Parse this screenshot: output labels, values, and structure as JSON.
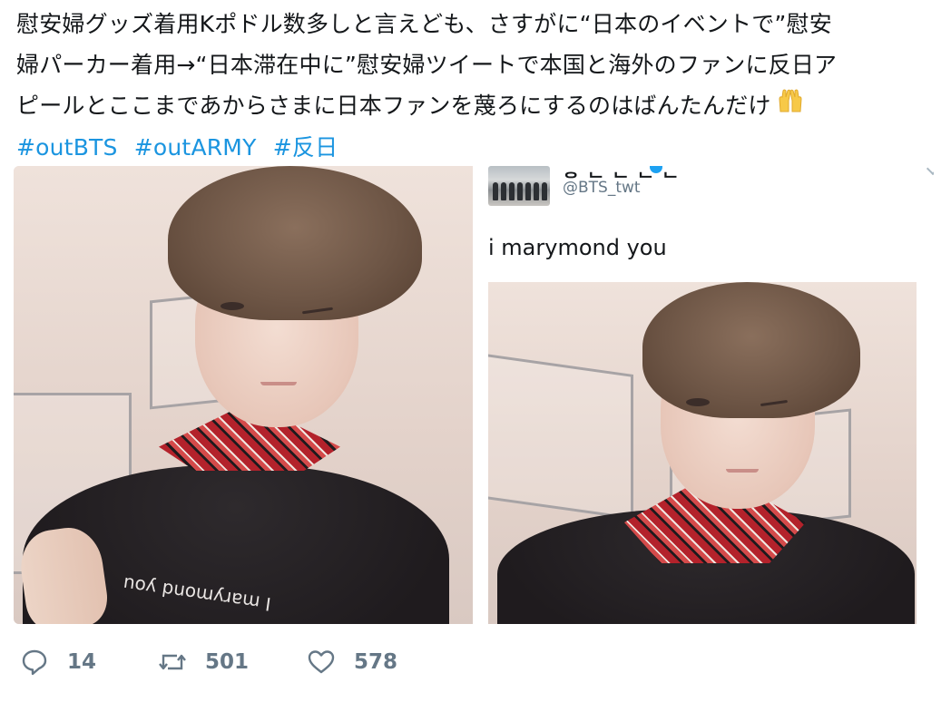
{
  "tweet": {
    "text_lines": [
      "慰安婦グッズ着用Kポドル数多しと言えども、さすがに“日本のイベントで”慰安",
      "婦パーカー着用→“日本滞在中に”慰安婦ツイートで本国と海外のファンに反日ア",
      "ピールとここまであからさまに日本ファンを蔑ろにするのはばんたんだけ"
    ],
    "emoji": "raising-hands",
    "hashtags": [
      "#outBTS",
      "#outARMY",
      "#反日"
    ]
  },
  "embedded_tweet": {
    "handle": "@BTS_twt",
    "caption": "i marymond you"
  },
  "photo_left": {
    "shirt_text": "I marymond you"
  },
  "actions": {
    "reply_count": "14",
    "retweet_count": "501",
    "like_count": "578"
  },
  "colors": {
    "text": "#14171a",
    "hashtag": "#1b95e0",
    "meta": "#657786"
  }
}
